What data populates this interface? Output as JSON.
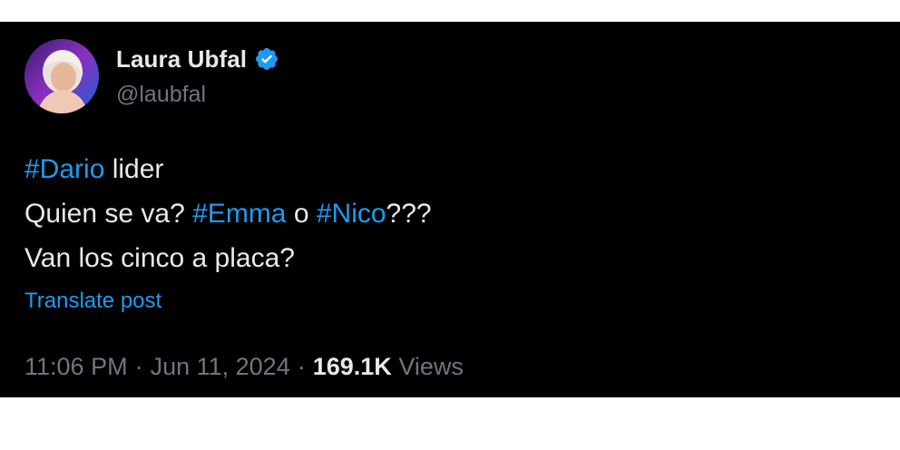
{
  "author": {
    "display_name": "Laura Ubfal",
    "handle": "@laubfal",
    "verified_color": "#1d9bf0"
  },
  "post": {
    "lines": [
      {
        "segments": [
          {
            "text": "#Dario",
            "hashtag": true
          },
          {
            "text": " lider",
            "hashtag": false
          }
        ]
      },
      {
        "segments": [
          {
            "text": "Quien se va? ",
            "hashtag": false
          },
          {
            "text": "#Emma",
            "hashtag": true
          },
          {
            "text": " o ",
            "hashtag": false
          },
          {
            "text": "#Nico",
            "hashtag": true
          },
          {
            "text": "???",
            "hashtag": false
          }
        ]
      },
      {
        "segments": [
          {
            "text": "Van los cinco a placa?",
            "hashtag": false
          }
        ]
      }
    ],
    "translate_label": "Translate post"
  },
  "meta": {
    "time": "11:06 PM",
    "separator": "·",
    "date": "Jun 11, 2024",
    "views_count": "169.1K",
    "views_label": "Views"
  },
  "colors": {
    "background": "#000000",
    "text": "#e7e9ea",
    "muted": "#71767b",
    "accent": "#1d9bf0"
  },
  "icons": {
    "verified": "verified-badge-icon"
  }
}
